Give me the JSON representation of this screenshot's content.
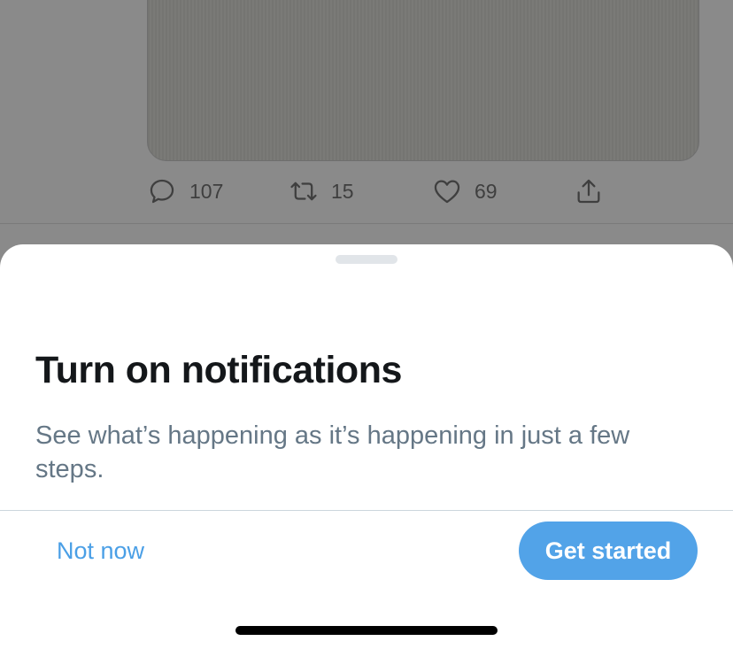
{
  "tweet": {
    "actions": [
      {
        "icon": "reply-icon",
        "count": "107"
      },
      {
        "icon": "retweet-icon",
        "count": "15"
      },
      {
        "icon": "like-icon",
        "count": "69"
      },
      {
        "icon": "share-icon"
      }
    ]
  },
  "sheet": {
    "title": "Turn on notifications",
    "description": "See what’s happening as it’s happening in just a few steps.",
    "secondary_button": "Not now",
    "primary_button": "Get started"
  },
  "colors": {
    "accent": "#4a9fe6",
    "primary_button_bg": "#52a3e8",
    "title": "#14171a",
    "secondary_text": "#657786"
  }
}
